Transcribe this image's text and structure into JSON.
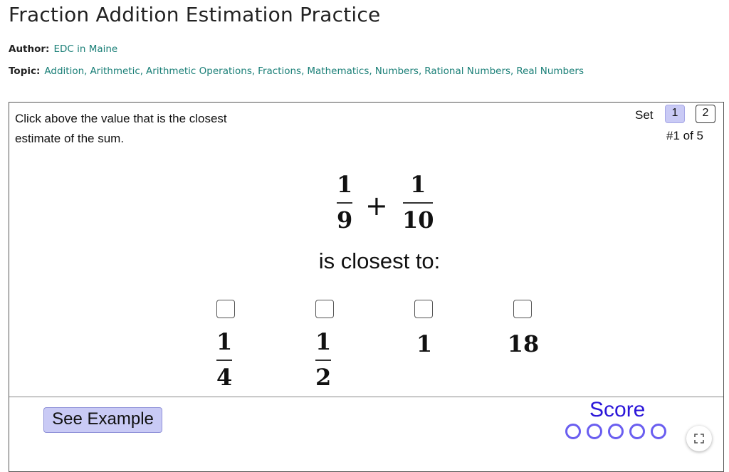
{
  "page": {
    "title": "Fraction Addition Estimation Practice"
  },
  "meta": {
    "author_label": "Author:",
    "author": "EDC in Maine",
    "topic_label": "Topic:",
    "topics": [
      "Addition",
      "Arithmetic",
      "Arithmetic Operations",
      "Fractions",
      "Mathematics",
      "Numbers",
      "Rational Numbers",
      "Real Numbers"
    ]
  },
  "applet": {
    "instruction": "Click above the value that is the closest estimate of the sum.",
    "set_label": "Set",
    "set_buttons": [
      "1",
      "2"
    ],
    "active_set": "1",
    "progress": "#1 of 5",
    "problem": {
      "fraction_a": {
        "numerator": "1",
        "denominator": "9"
      },
      "operator": "+",
      "fraction_b": {
        "numerator": "1",
        "denominator": "10"
      }
    },
    "prompt": "is closest to:",
    "choices": [
      {
        "numerator": "1",
        "denominator": "4",
        "checked": false
      },
      {
        "numerator": "1",
        "denominator": "2",
        "checked": false
      },
      {
        "value": "1",
        "checked": false
      },
      {
        "value": "18",
        "checked": false
      }
    ],
    "see_example_label": "See Example",
    "score_label": "Score",
    "score_slots": 5,
    "score_filled": 0
  },
  "colors": {
    "link": "#1a7f77",
    "button_fill": "#c9caf5",
    "score": "#2b16d9",
    "score_ring": "#6a5ef0"
  },
  "icons": {
    "fullscreen": "expand-icon"
  }
}
